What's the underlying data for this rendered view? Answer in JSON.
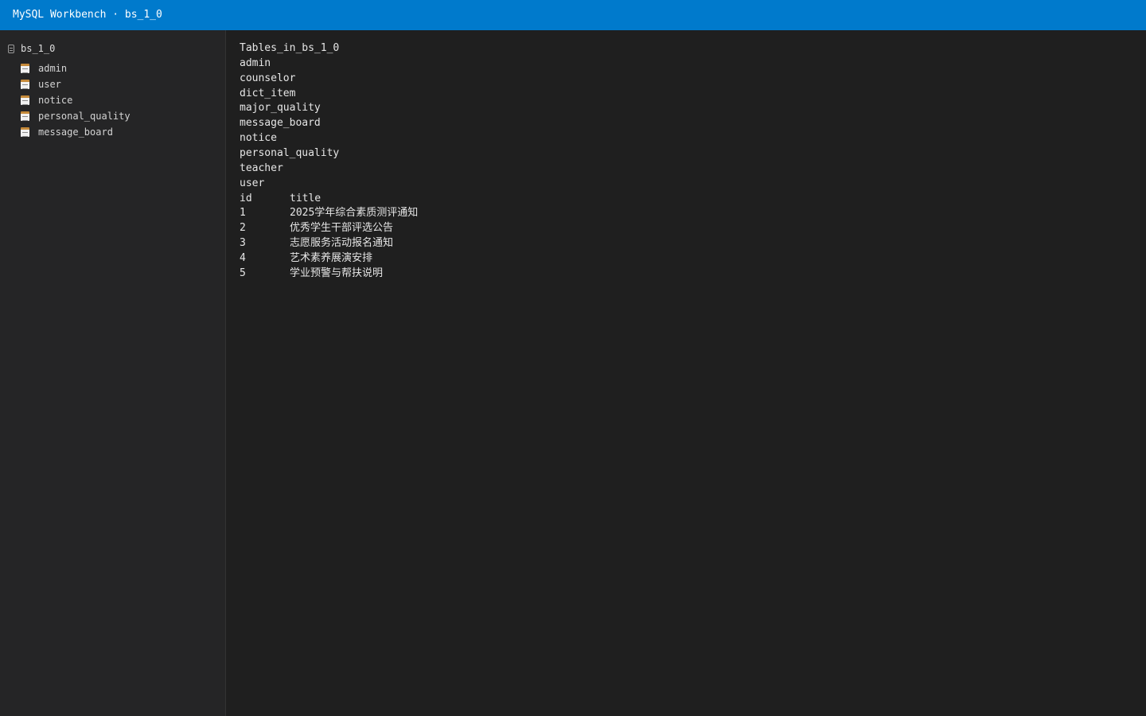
{
  "window": {
    "title": "MySQL Workbench · bs_1_0"
  },
  "sidebar": {
    "database": "bs_1_0",
    "tables": [
      {
        "name": "admin"
      },
      {
        "name": "user"
      },
      {
        "name": "notice"
      },
      {
        "name": "personal_quality"
      },
      {
        "name": "message_board"
      }
    ]
  },
  "output": {
    "tables_header": "Tables_in_bs_1_0",
    "tables": [
      "admin",
      "counselor",
      "dict_item",
      "major_quality",
      "message_board",
      "notice",
      "personal_quality",
      "teacher",
      "user"
    ],
    "query_result": {
      "columns": [
        "id",
        "title"
      ],
      "rows": [
        [
          "1",
          "2025学年综合素质测评通知"
        ],
        [
          "2",
          "优秀学生干部评选公告"
        ],
        [
          "3",
          "志愿服务活动报名通知"
        ],
        [
          "4",
          "艺术素养展演安排"
        ],
        [
          "5",
          "学业预警与帮扶说明"
        ]
      ]
    }
  }
}
